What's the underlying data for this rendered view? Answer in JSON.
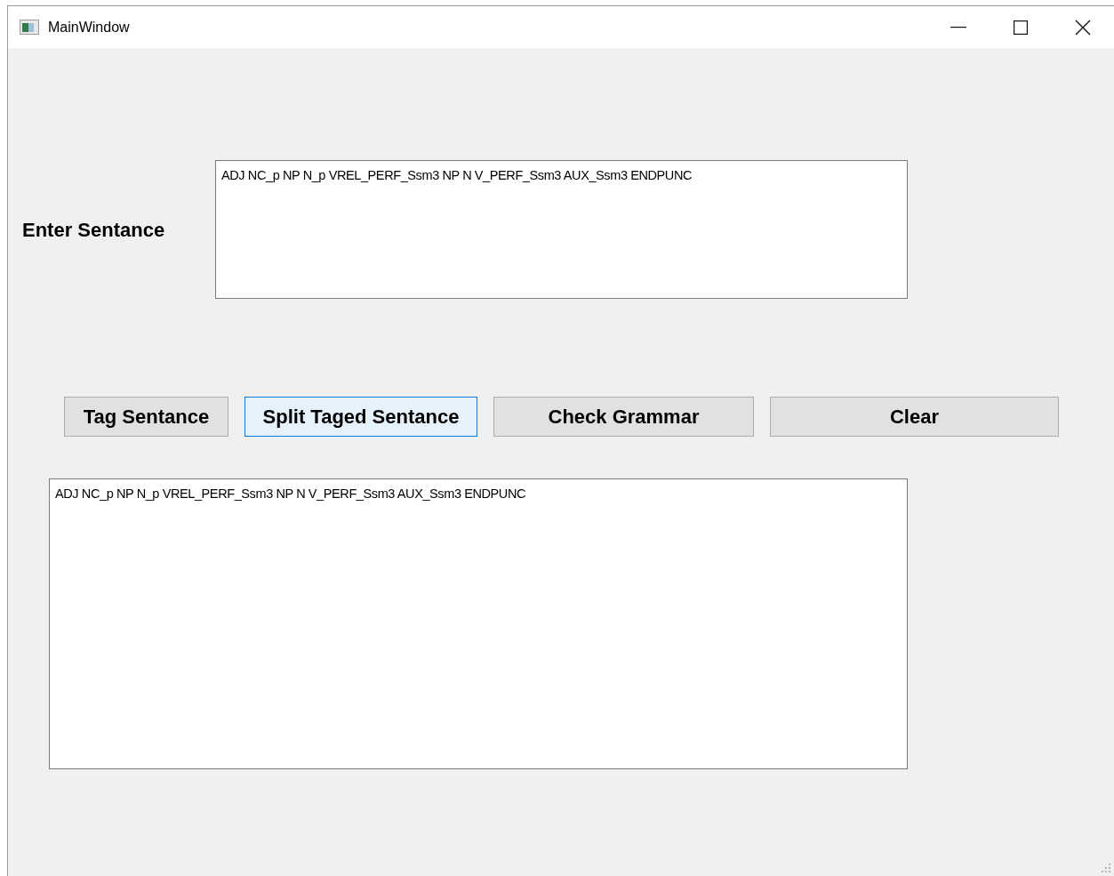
{
  "window": {
    "title": "MainWindow"
  },
  "input": {
    "label": "Enter Sentance",
    "value": "ADJ NC_p NP N_p VREL_PERF_Ssm3 NP N V_PERF_Ssm3 AUX_Ssm3 ENDPUNC"
  },
  "buttons": [
    {
      "label": "Tag Sentance",
      "focused": false
    },
    {
      "label": "Split Taged Sentance",
      "focused": true
    },
    {
      "label": "Check Grammar",
      "focused": false
    },
    {
      "label": "Clear",
      "focused": false
    }
  ],
  "output": {
    "value": "ADJ NC_p NP N_p VREL_PERF_Ssm3 NP N V_PERF_Ssm3 AUX_Ssm3 ENDPUNC"
  }
}
